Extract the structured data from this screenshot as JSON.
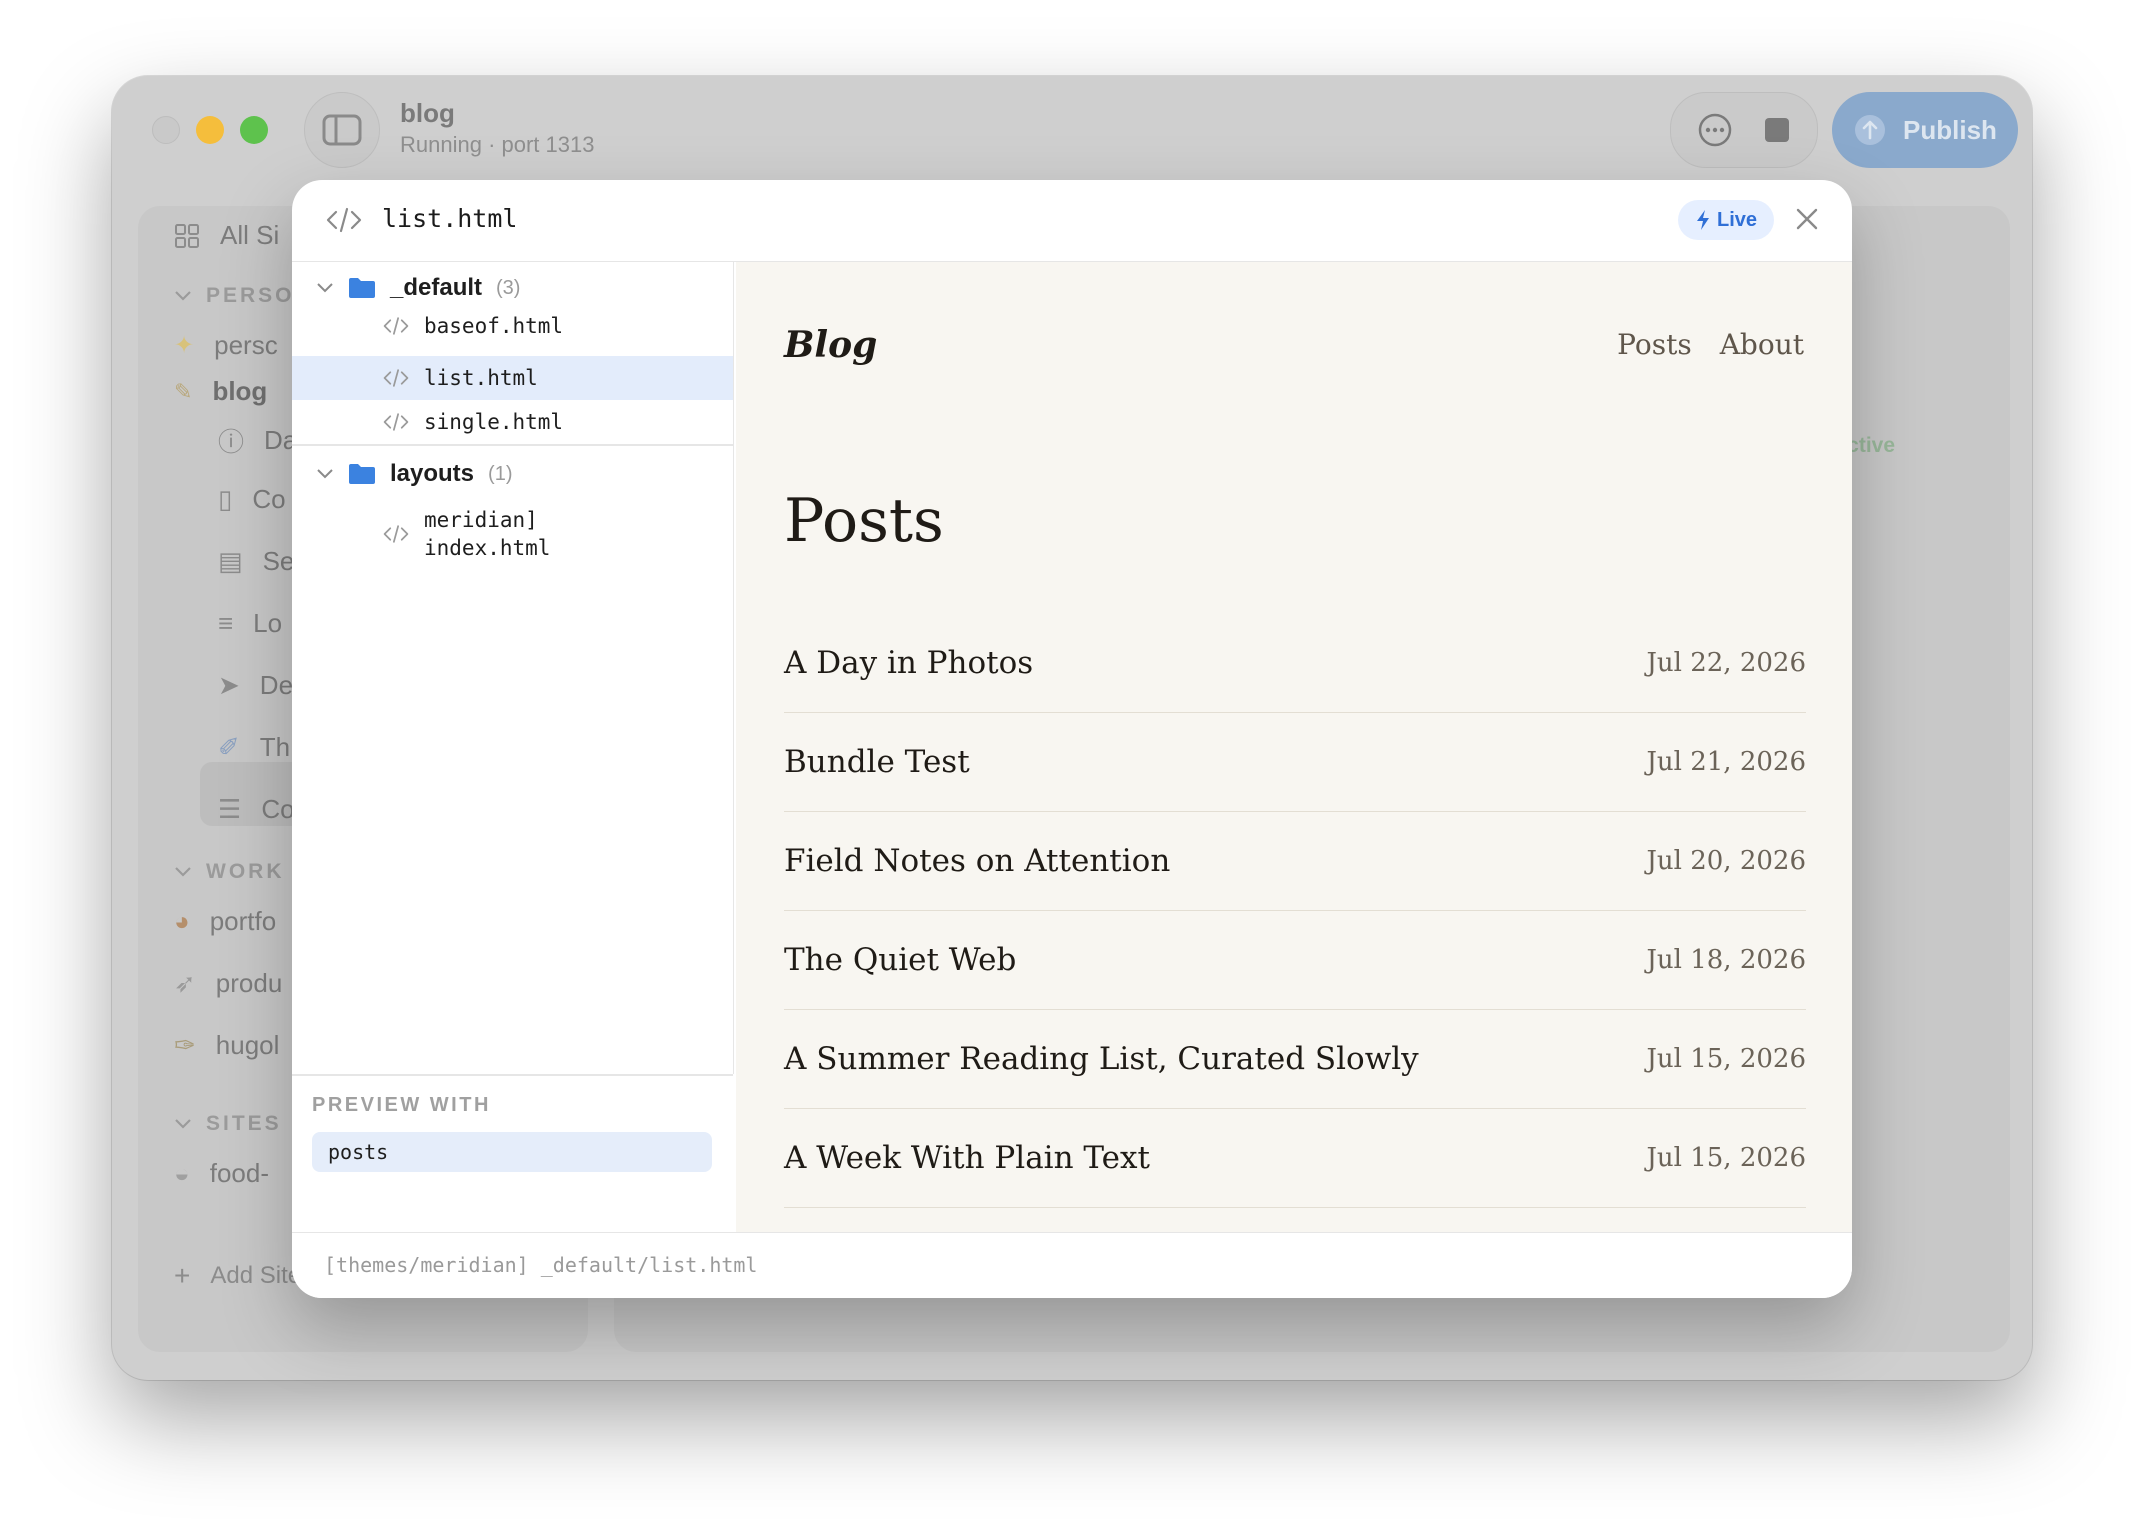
{
  "titlebar": {
    "site_name": "blog",
    "status": "Running · port 1313",
    "publish_label": "Publish"
  },
  "sidebar": {
    "all_sites": "All Si",
    "section_personal": "PERSON",
    "personal_items": [
      "persc",
      "blog"
    ],
    "blog_subitems": [
      "Da",
      "Co",
      "Se",
      "Lo",
      "De",
      "Th",
      "Co"
    ],
    "section_work": "WORK",
    "work_items": [
      "portfo",
      "produ",
      "hugol"
    ],
    "section_sites": "SITES",
    "sites_items": [
      "food-"
    ],
    "add_site": "Add Site"
  },
  "main": {
    "active_badge": "Active"
  },
  "modal": {
    "title": "list.html",
    "live_label": "Live",
    "tree": {
      "folders": [
        {
          "name": "_default",
          "count": "(3)",
          "files": [
            "baseof.html",
            "list.html",
            "single.html"
          ]
        },
        {
          "name": "layouts",
          "count": "(1)",
          "files": [
            "meridian]\nindex.html"
          ]
        }
      ],
      "selected_file": "list.html"
    },
    "preview_with": {
      "label": "PREVIEW WITH",
      "value": "posts"
    },
    "preview": {
      "brand": "Blog",
      "nav": [
        "Posts",
        "About"
      ],
      "heading": "Posts",
      "posts": [
        {
          "title": "A Day in Photos",
          "date": "Jul 22, 2026"
        },
        {
          "title": "Bundle Test",
          "date": "Jul 21, 2026"
        },
        {
          "title": "Field Notes on Attention",
          "date": "Jul 20, 2026"
        },
        {
          "title": "The Quiet Web",
          "date": "Jul 18, 2026"
        },
        {
          "title": "A Summer Reading List, Curated Slowly",
          "date": "Jul 15, 2026"
        },
        {
          "title": "A Week With Plain Text",
          "date": "Jul 15, 2026"
        }
      ]
    },
    "footer_path": "[themes/meridian] _default/list.html"
  }
}
